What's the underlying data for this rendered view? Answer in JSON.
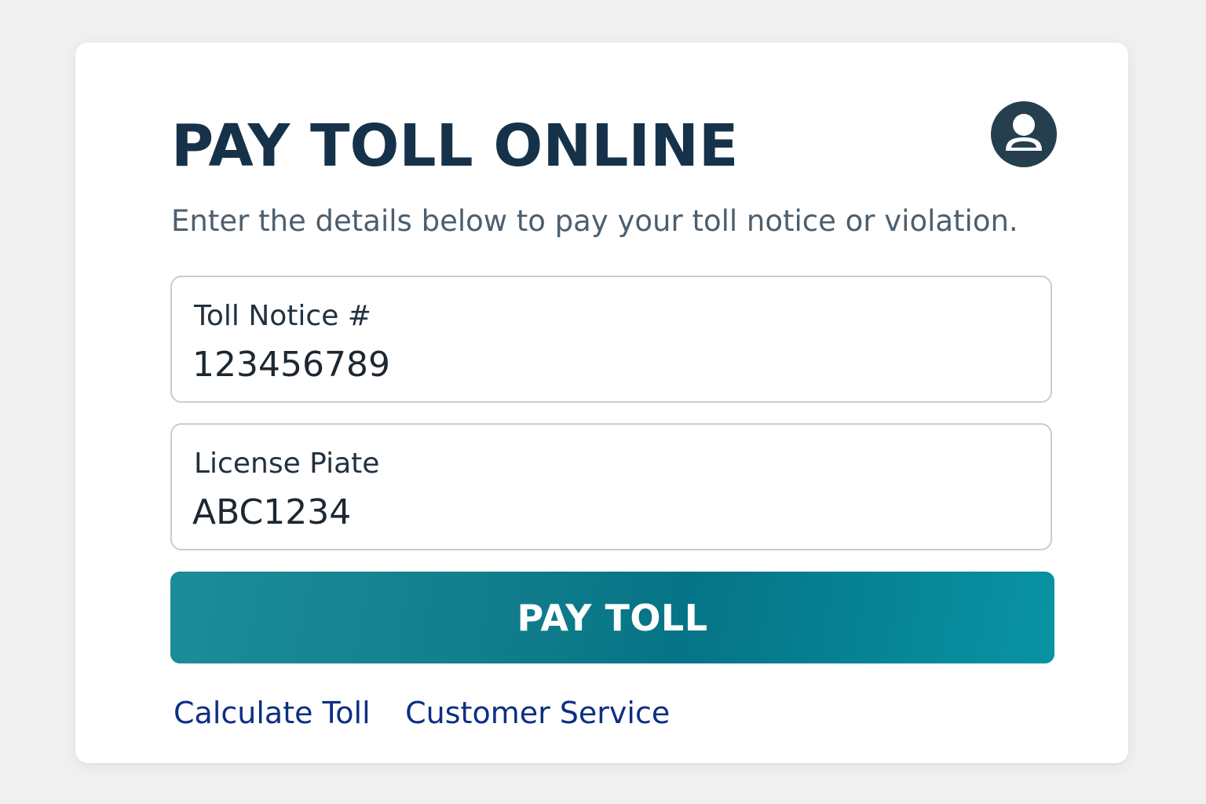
{
  "header": {
    "title": "PAY TOLL ONLINE",
    "subtitle": "Enter the details below to pay your toll notice or violation.",
    "avatar_icon": "user-profile-icon"
  },
  "form": {
    "toll_notice": {
      "label": "Toll Notice #",
      "value": "123456789"
    },
    "license_plate": {
      "label": "License Piate",
      "value": "ABC1234"
    },
    "submit_label": "PAY TOLL"
  },
  "links": {
    "calculate_toll": "Calculate Toll",
    "customer_service": "Customer Service"
  },
  "colors": {
    "title": "#16324a",
    "accent": "#057486",
    "link": "#0d2f82",
    "background": "#eff0ef"
  }
}
